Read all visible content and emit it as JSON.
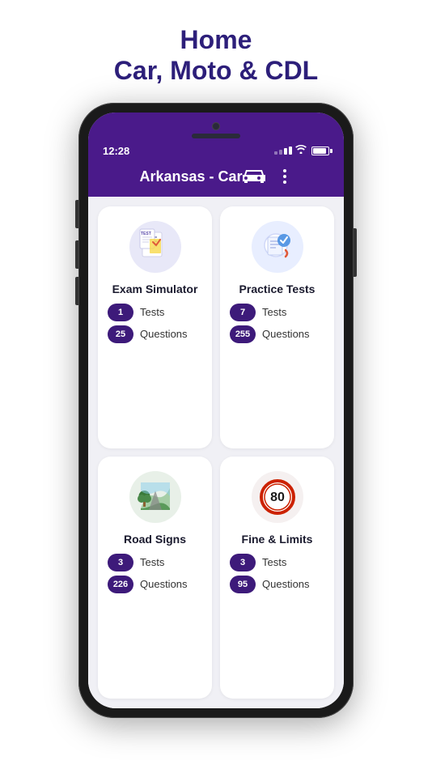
{
  "page": {
    "title_line1": "Home",
    "title_line2": "Car, Moto & CDL"
  },
  "status_bar": {
    "time": "12:28"
  },
  "header": {
    "title": "Arkansas - Car"
  },
  "cards": [
    {
      "id": "exam_simulator",
      "label": "Exam Simulator",
      "stats": [
        {
          "badge": "1",
          "label": "Tests"
        },
        {
          "badge": "25",
          "label": "Questions"
        }
      ]
    },
    {
      "id": "practice_tests",
      "label": "Practice Tests",
      "stats": [
        {
          "badge": "7",
          "label": "Tests"
        },
        {
          "badge": "255",
          "label": "Questions"
        }
      ]
    },
    {
      "id": "road_signs",
      "label": "Road Signs",
      "stats": [
        {
          "badge": "3",
          "label": "Tests"
        },
        {
          "badge": "226",
          "label": "Questions"
        }
      ]
    },
    {
      "id": "fine_limits",
      "label": "Fine & Limits",
      "stats": [
        {
          "badge": "3",
          "label": "Tests"
        },
        {
          "badge": "95",
          "label": "Questions"
        }
      ]
    }
  ]
}
